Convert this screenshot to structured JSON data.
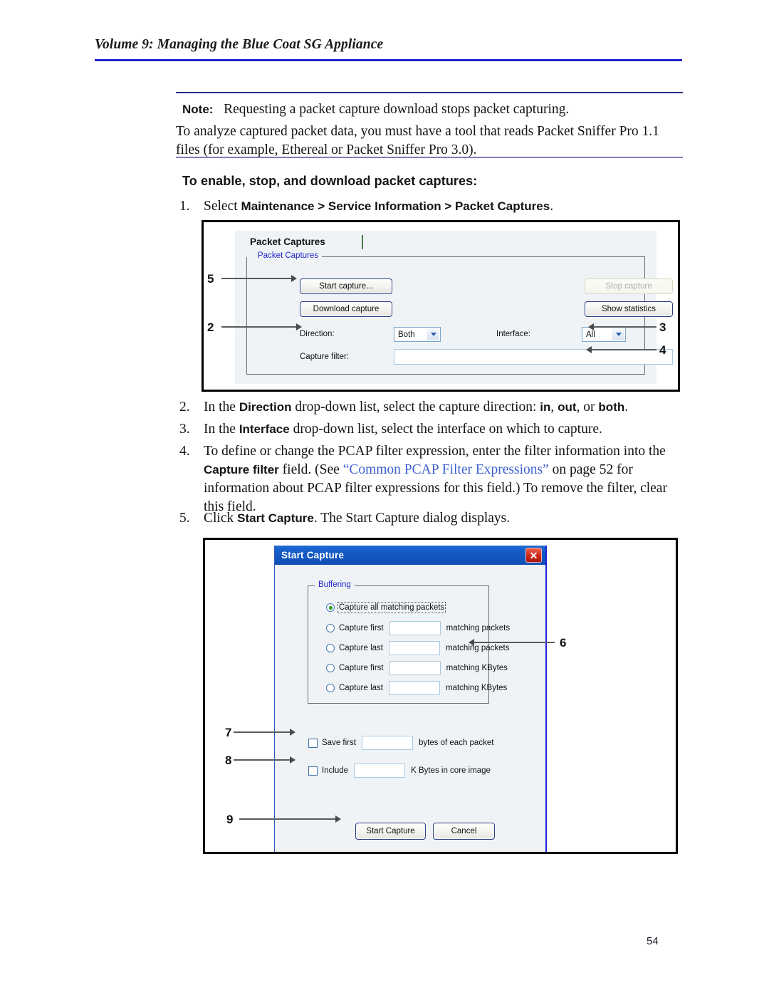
{
  "header": {
    "title": "Volume 9: Managing the Blue Coat SG Appliance"
  },
  "note": {
    "label": "Note:",
    "text": "Requesting a packet capture download stops packet capturing.",
    "paragraph": "To analyze captured packet data, you must have a tool that reads Packet Sniffer Pro 1.1 files (for example, Ethereal or Packet Sniffer Pro 3.0)."
  },
  "subheading": "To enable, stop, and download packet captures:",
  "steps": {
    "s1": {
      "num": "1.",
      "pre": "Select ",
      "bold": "Maintenance > Service Information > Packet Captures",
      "post": "."
    },
    "s2": {
      "num": "2.",
      "pre": "In the ",
      "b1": "Direction",
      "mid": " drop-down list, select the capture direction: ",
      "b2": "in",
      "mid2": ", ",
      "b3": "out",
      "mid3": ", or ",
      "b4": "both",
      "post": "."
    },
    "s3": {
      "num": "3.",
      "pre": "In the ",
      "b1": "Interface",
      "post": " drop-down list, select the interface on which to capture."
    },
    "s4": {
      "num": "4.",
      "line1": "To define or change the PCAP filter expression, enter the filter information into the",
      "b1": "Capture filter",
      "mid1": " field. (See ",
      "link": "“Common PCAP Filter Expressions”",
      "mid2": " on page 52 for",
      "line3": "information about PCAP filter expressions for this field.) To remove the filter, clear",
      "line4": "this field."
    },
    "s5": {
      "num": "5.",
      "pre": "Click ",
      "b1": "Start Capture",
      "post": ". The Start Capture dialog displays."
    }
  },
  "figure1": {
    "tab_title": "Packet Captures",
    "group_legend": "Packet Captures",
    "buttons": {
      "start_capture": "Start capture...",
      "download_capture": "Download capture",
      "stop_capture": "Stop capture",
      "show_statistics": "Show statistics"
    },
    "fields": {
      "direction_label": "Direction:",
      "direction_value": "Both",
      "interface_label": "Interface:",
      "interface_value": "All",
      "capture_filter_label": "Capture filter:",
      "capture_filter_value": ""
    },
    "callouts": {
      "c5": "5",
      "c2": "2",
      "c3": "3",
      "c4": "4"
    }
  },
  "figure2": {
    "title": "Start Capture",
    "close_glyph": "✕",
    "group_legend": "Buffering",
    "radios": [
      {
        "label": "Capture all matching packets",
        "selected": true,
        "has_input": false,
        "input_value": "",
        "tail": ""
      },
      {
        "label": "Capture first",
        "selected": false,
        "has_input": true,
        "input_value": "",
        "tail": "matching packets"
      },
      {
        "label": "Capture last",
        "selected": false,
        "has_input": true,
        "input_value": "",
        "tail": "matching packets"
      },
      {
        "label": "Capture first",
        "selected": false,
        "has_input": true,
        "input_value": "",
        "tail": "matching KBytes"
      },
      {
        "label": "Capture last",
        "selected": false,
        "has_input": true,
        "input_value": "",
        "tail": "matching KBytes"
      }
    ],
    "checkboxes": [
      {
        "label": "Save first",
        "checked": false,
        "input_value": "",
        "tail": "bytes of each packet"
      },
      {
        "label": "Include",
        "checked": false,
        "input_value": "",
        "tail": "K Bytes in core image"
      }
    ],
    "buttons": {
      "start_capture": "Start Capture",
      "cancel": "Cancel"
    },
    "callouts": {
      "c6": "6",
      "c7": "7",
      "c8": "8",
      "c9": "9"
    }
  },
  "page_number": "54"
}
